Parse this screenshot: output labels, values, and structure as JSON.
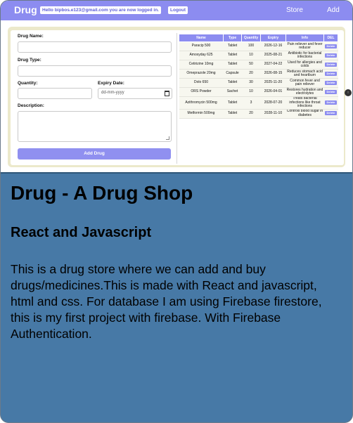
{
  "navbar": {
    "brand": "Drug",
    "login_message": "Hello bipbos.e123@gmail.com you are now logged in.",
    "logout_label": "Logout",
    "store_link": "Store",
    "add_link": "Add"
  },
  "form": {
    "name_label": "Drug Name:",
    "type_label": "Drug Type:",
    "quantity_label": "Quantity:",
    "expiry_label": "Expiry Date:",
    "expiry_placeholder": "dd-mm-yyyy",
    "description_label": "Description:",
    "submit_label": "Add Drug"
  },
  "table": {
    "headers": [
      "Name",
      "Type",
      "Quantity",
      "Expiry",
      "Info",
      "DEL"
    ],
    "delete_label": "Delete",
    "rows": [
      [
        "Paracip 500",
        "Tablet",
        "100",
        "2026-12-16",
        "Pain reliever and fever reducer"
      ],
      [
        "Amoxyday 625",
        "Tablet",
        "10",
        "2025-08-21",
        "Antibiotic for bacterial infections"
      ],
      [
        "Cetirizine 10mg",
        "Tablet",
        "50",
        "2027-04-22",
        "Used for allergies and colds"
      ],
      [
        "Omeprazole 20mg",
        "Capsule",
        "20",
        "2026-08-15",
        "Reduces stomach acid and heartburn"
      ],
      [
        "Dolo 650",
        "Tablet",
        "30",
        "2025-11-20",
        "Common fever and pain reliever"
      ],
      [
        "ORS Powder",
        "Sachet",
        "10",
        "2026-04-01",
        "Restores hydration and electrolytes"
      ],
      [
        "Azithromycin 500mg",
        "Tablet",
        "3",
        "2028-07-20",
        "Treats bacterial infections like throat infections"
      ],
      [
        "Metformin 500mg",
        "Tablet",
        "20",
        "2028-11-10",
        "Controls blood sugar in diabetes"
      ]
    ]
  },
  "scroll_button_label": "↑",
  "readme": {
    "title": "Drug - A Drug Shop",
    "subtitle": "React and Javascript",
    "description": "This is a drug store where we can add and buy drugs/medicines.This is made with React and javascript, html and css. For database I am using Firebase firestore, this is my first project with firebase. With Firebase Authentication."
  }
}
